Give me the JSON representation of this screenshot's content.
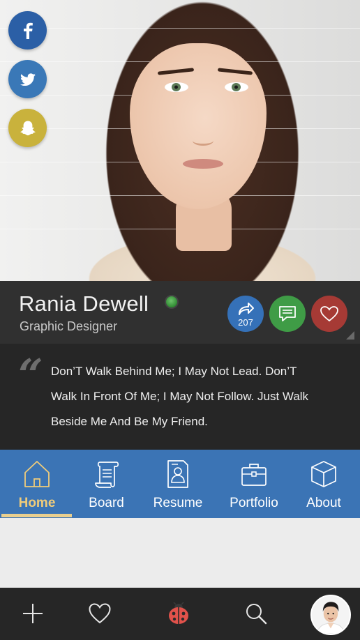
{
  "profile": {
    "name": "Rania Dewell",
    "role": "Graphic Designer",
    "status": "online",
    "share_count": "207"
  },
  "social": [
    {
      "icon": "facebook-icon",
      "color": "#2b5fa6"
    },
    {
      "icon": "twitter-icon",
      "color": "#3a78b7"
    },
    {
      "icon": "snapchat-icon",
      "color": "#c9b23c"
    }
  ],
  "quote": {
    "lines": [
      "Don’T Walk Behind Me; I May Not Lead. Don’T",
      "Walk In Front Of Me; I May Not Follow. Just Walk",
      "Beside  Me And Be My Friend."
    ]
  },
  "tabs": [
    {
      "label": "Home",
      "icon": "home-icon",
      "active": true
    },
    {
      "label": "Board",
      "icon": "scroll-icon",
      "active": false
    },
    {
      "label": "Resume",
      "icon": "resume-icon",
      "active": false
    },
    {
      "label": "Portfolio",
      "icon": "briefcase-icon",
      "active": false
    },
    {
      "label": "About",
      "icon": "cube-icon",
      "active": false
    }
  ],
  "bottom_nav": [
    {
      "icon": "plus-icon"
    },
    {
      "icon": "heart-icon"
    },
    {
      "icon": "ladybug-icon"
    },
    {
      "icon": "search-icon"
    },
    {
      "icon": "user-avatar"
    }
  ],
  "colors": {
    "tab_bar": "#3b74b5",
    "active_tab": "#f0cc7a",
    "share": "#3571b8",
    "chat": "#3f9c46",
    "like": "#a63a35",
    "status_online": "#3e9a3f"
  }
}
